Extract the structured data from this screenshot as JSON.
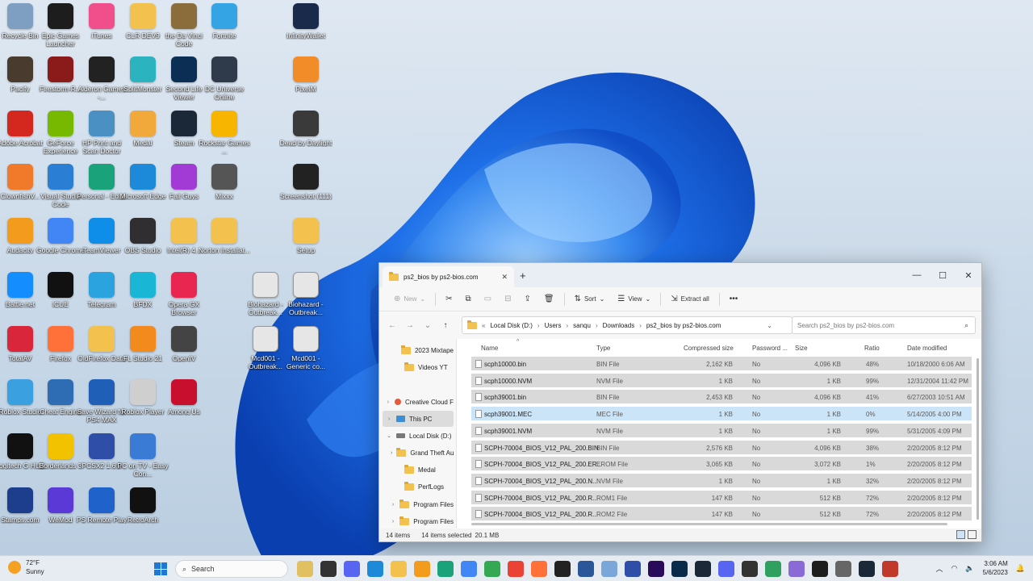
{
  "desktop": {
    "icons": [
      {
        "label": "Recycle Bin",
        "icon": "recycle-bin-icon",
        "color": "#7f9fc2"
      },
      {
        "label": "Epic Games Launcher",
        "icon": "epic-games-icon",
        "color": "#1d1d1d"
      },
      {
        "label": "iTunes",
        "icon": "itunes-icon",
        "color": "#f04f8c"
      },
      {
        "label": "CLR DEV9",
        "icon": "folder-icon",
        "color": "#f2c14e"
      },
      {
        "label": "the Da Vinci Code",
        "icon": "game-icon",
        "color": "#8a6d3b"
      },
      {
        "label": "Fortnite",
        "icon": "fortnite-icon",
        "color": "#35a4e5"
      },
      {
        "label": "InfinityWallet",
        "icon": "wallet-icon",
        "color": "#1a2a4a"
      },
      {
        "label": "Pacify",
        "icon": "game-icon",
        "color": "#4a3b2f"
      },
      {
        "label": "Firestorm-R...",
        "icon": "firestorm-icon",
        "color": "#8b1b1b"
      },
      {
        "label": "Alderon Games -...",
        "icon": "alderon-icon",
        "color": "#222222"
      },
      {
        "label": "SplitMonster",
        "icon": "app-icon",
        "color": "#2bb3c0"
      },
      {
        "label": "Second Life Viewer",
        "icon": "second-life-icon",
        "color": "#0b2e55"
      },
      {
        "label": "DC Universe Online",
        "icon": "game-icon",
        "color": "#2f3b4a"
      },
      {
        "label": "PixelM",
        "icon": "pixel-icon",
        "color": "#f28c28"
      },
      {
        "label": "Adobe Acrobat",
        "icon": "acrobat-icon",
        "color": "#d4271d"
      },
      {
        "label": "GeForce Experience",
        "icon": "nvidia-icon",
        "color": "#76b900"
      },
      {
        "label": "HP Print and Scan Doctor",
        "icon": "printer-icon",
        "color": "#4a90c2"
      },
      {
        "label": "Medal",
        "icon": "medal-icon",
        "color": "#f2a93b"
      },
      {
        "label": "Steam",
        "icon": "steam-icon",
        "color": "#1b2838"
      },
      {
        "label": "Rockstar Games ...",
        "icon": "rockstar-icon",
        "color": "#f7b500"
      },
      {
        "label": "Dead by Daylight",
        "icon": "dbd-icon",
        "color": "#3a3a3a"
      },
      {
        "label": "ClownfishV...",
        "icon": "clownfish-icon",
        "color": "#f07a2a"
      },
      {
        "label": "Visual Studio Code",
        "icon": "vscode-icon",
        "color": "#2a7fd4"
      },
      {
        "label": "Personal - Edge",
        "icon": "edge-icon",
        "color": "#1aa37a"
      },
      {
        "label": "Microsoft Edge",
        "icon": "edge-icon",
        "color": "#1c8ad8"
      },
      {
        "label": "Fall Guys",
        "icon": "fall-guys-icon",
        "color": "#a23bd6"
      },
      {
        "label": "Mixxx",
        "icon": "mixxx-icon",
        "color": "#555555"
      },
      {
        "label": "Screenshot (111)",
        "icon": "image-icon",
        "color": "#222222"
      },
      {
        "label": "Audacity",
        "icon": "audacity-icon",
        "color": "#f29b1d"
      },
      {
        "label": "Google Chrome",
        "icon": "chrome-icon",
        "color": "#4285f4"
      },
      {
        "label": "TeamViewer",
        "icon": "teamviewer-icon",
        "color": "#0e8ee9"
      },
      {
        "label": "OBS Studio",
        "icon": "obs-icon",
        "color": "#302e31"
      },
      {
        "label": "Intel(R) 4...",
        "icon": "folder-icon",
        "color": "#f2c14e"
      },
      {
        "label": "Norton Installat...",
        "icon": "folder-icon",
        "color": "#f2c14e"
      },
      {
        "label": "Setup",
        "icon": "folder-icon",
        "color": "#f2c14e"
      },
      {
        "label": "Battle.net",
        "icon": "battlenet-icon",
        "color": "#148eff"
      },
      {
        "label": "iCUE",
        "icon": "icue-icon",
        "color": "#111111"
      },
      {
        "label": "Telegram",
        "icon": "telegram-icon",
        "color": "#2aa3df"
      },
      {
        "label": "BFDX",
        "icon": "play-icon",
        "color": "#1ab6d6"
      },
      {
        "label": "Opera GX Browser",
        "icon": "opera-icon",
        "color": "#e8264f"
      },
      {
        "label": "Biohazard - Outbreak...",
        "icon": "file-icon",
        "color": "#e6e6e6"
      },
      {
        "label": "Biohazard - Outbreak...",
        "icon": "file-icon",
        "color": "#e6e6e6"
      },
      {
        "label": "TotalAV",
        "icon": "shield-icon",
        "color": "#d9263a"
      },
      {
        "label": "Firefox",
        "icon": "firefox-icon",
        "color": "#ff7139"
      },
      {
        "label": "OldFirefox Data",
        "icon": "folder-icon",
        "color": "#f2c14e"
      },
      {
        "label": "FL Studio 21",
        "icon": "fl-studio-icon",
        "color": "#f28a1e"
      },
      {
        "label": "OpenIV",
        "icon": "openiv-icon",
        "color": "#444444"
      },
      {
        "label": "Mcd001 - Outbreak...",
        "icon": "file-icon",
        "color": "#e6e6e6"
      },
      {
        "label": "Mcd001 - Generic co...",
        "icon": "file-icon",
        "color": "#e6e6e6"
      },
      {
        "label": "Roblox Studio",
        "icon": "roblox-studio-icon",
        "color": "#3aa0e0"
      },
      {
        "label": "Cheat Engine",
        "icon": "cheat-engine-icon",
        "color": "#2e6db4"
      },
      {
        "label": "Save Wizard for PS4 MAX",
        "icon": "save-wizard-icon",
        "color": "#1f5fb8"
      },
      {
        "label": "Roblox Player",
        "icon": "roblox-icon",
        "color": "#cfcfcf"
      },
      {
        "label": "Among Us",
        "icon": "among-us-icon",
        "color": "#c8102e"
      },
      {
        "label": "Logitech G HUB",
        "icon": "ghub-icon",
        "color": "#111111"
      },
      {
        "label": "Borderlands 3",
        "icon": "borderlands-icon",
        "color": "#f2c200"
      },
      {
        "label": "PCSX2 1.6.0",
        "icon": "pcsx2-icon",
        "color": "#2f4ea8"
      },
      {
        "label": "PC on TV - Easy Con...",
        "icon": "app-icon",
        "color": "#3a7bd5"
      },
      {
        "label": "Stamps.com",
        "icon": "stamps-icon",
        "color": "#1d3e8c"
      },
      {
        "label": "WeMod",
        "icon": "wemod-icon",
        "color": "#5a39d6"
      },
      {
        "label": "PS Remote Play",
        "icon": "ps-remote-icon",
        "color": "#1f62c9"
      },
      {
        "label": "RetroArch",
        "icon": "retroarch-icon",
        "color": "#111111"
      }
    ]
  },
  "explorer": {
    "tab_title": "ps2_bios by ps2-bios.com",
    "toolbar": {
      "new_label": "New",
      "sort_label": "Sort",
      "view_label": "View",
      "extract_label": "Extract all"
    },
    "breadcrumb": [
      "Local Disk (D:)",
      "Users",
      "sanqu",
      "Downloads",
      "ps2_bios by ps2-bios.com"
    ],
    "search_placeholder": "Search ps2_bios by ps2-bios.com",
    "nav": [
      {
        "label": "2023 Mixtape",
        "icon": "folder-icon"
      },
      {
        "label": "Videos YT",
        "icon": "folder-icon"
      },
      {
        "label": "Creative Cloud F",
        "icon": "cloud-icon"
      },
      {
        "label": "This PC",
        "icon": "pc-icon"
      },
      {
        "label": "Local Disk (D:)",
        "icon": "drive-icon"
      },
      {
        "label": "Grand Theft Au",
        "icon": "folder-icon"
      },
      {
        "label": "Medal",
        "icon": "folder-icon"
      },
      {
        "label": "PerfLogs",
        "icon": "folder-icon"
      },
      {
        "label": "Program Files",
        "icon": "folder-icon"
      },
      {
        "label": "Program Files",
        "icon": "folder-icon"
      }
    ],
    "columns": [
      "Name",
      "Type",
      "Compressed size",
      "Password ...",
      "Size",
      "Ratio",
      "Date modified"
    ],
    "files": [
      {
        "name": "scph10000.bin",
        "type": "BIN File",
        "compressed": "2,162 KB",
        "password": "No",
        "size": "4,096 KB",
        "ratio": "48%",
        "date": "10/18/2000 6:06 AM"
      },
      {
        "name": "scph10000.NVM",
        "type": "NVM File",
        "compressed": "1 KB",
        "password": "No",
        "size": "1 KB",
        "ratio": "99%",
        "date": "12/31/2004 11:42 PM"
      },
      {
        "name": "scph39001.bin",
        "type": "BIN File",
        "compressed": "2,453 KB",
        "password": "No",
        "size": "4,096 KB",
        "ratio": "41%",
        "date": "6/27/2003 10:51 AM"
      },
      {
        "name": "scph39001.MEC",
        "type": "MEC File",
        "compressed": "1 KB",
        "password": "No",
        "size": "1 KB",
        "ratio": "0%",
        "date": "5/14/2005 4:00 PM"
      },
      {
        "name": "scph39001.NVM",
        "type": "NVM File",
        "compressed": "1 KB",
        "password": "No",
        "size": "1 KB",
        "ratio": "99%",
        "date": "5/31/2005 4:09 PM"
      },
      {
        "name": "SCPH-70004_BIOS_V12_PAL_200.BIN",
        "type": "BIN File",
        "compressed": "2,576 KB",
        "password": "No",
        "size": "4,096 KB",
        "ratio": "38%",
        "date": "2/20/2005 8:12 PM"
      },
      {
        "name": "SCPH-70004_BIOS_V12_PAL_200.ER...",
        "type": "EROM File",
        "compressed": "3,065 KB",
        "password": "No",
        "size": "3,072 KB",
        "ratio": "1%",
        "date": "2/20/2005 8:12 PM"
      },
      {
        "name": "SCPH-70004_BIOS_V12_PAL_200.N...",
        "type": "NVM File",
        "compressed": "1 KB",
        "password": "No",
        "size": "1 KB",
        "ratio": "32%",
        "date": "2/20/2005 8:12 PM"
      },
      {
        "name": "SCPH-70004_BIOS_V12_PAL_200.R...",
        "type": "ROM1 File",
        "compressed": "147 KB",
        "password": "No",
        "size": "512 KB",
        "ratio": "72%",
        "date": "2/20/2005 8:12 PM"
      },
      {
        "name": "SCPH-70004_BIOS_V12_PAL_200.R...",
        "type": "ROM2 File",
        "compressed": "147 KB",
        "password": "No",
        "size": "512 KB",
        "ratio": "72%",
        "date": "2/20/2005 8:12 PM"
      }
    ],
    "status": {
      "count": "14 items",
      "selected": "14 items selected",
      "size": "20.1 MB"
    }
  },
  "taskbar": {
    "weather_temp": "72°F",
    "weather_desc": "Sunny",
    "search_label": "Search",
    "time": "3:06 AM",
    "date": "5/6/2023",
    "apps": [
      {
        "name": "shrine-app-icon",
        "color": "#e0c060"
      },
      {
        "name": "terminal-icon",
        "color": "#333333"
      },
      {
        "name": "discord-icon",
        "color": "#5865f2"
      },
      {
        "name": "edge-icon",
        "color": "#1c8ad8"
      },
      {
        "name": "file-explorer-icon",
        "color": "#f2c14e"
      },
      {
        "name": "audacity-icon",
        "color": "#f29b1d"
      },
      {
        "name": "edge-icon",
        "color": "#1aa37a"
      },
      {
        "name": "chrome-icon",
        "color": "#4285f4"
      },
      {
        "name": "chrome-icon",
        "color": "#34a853"
      },
      {
        "name": "chrome-icon",
        "color": "#ea4335"
      },
      {
        "name": "firefox-icon",
        "color": "#ff7139"
      },
      {
        "name": "alderon-icon",
        "color": "#222222"
      },
      {
        "name": "word-icon",
        "color": "#2b579a"
      },
      {
        "name": "image-icon",
        "color": "#7aa6d9"
      },
      {
        "name": "pcsx2-icon",
        "color": "#2f4ea8"
      },
      {
        "name": "premiere-icon",
        "color": "#2a0a5a"
      },
      {
        "name": "photoshop-icon",
        "color": "#0b2b4a"
      },
      {
        "name": "steam-icon",
        "color": "#1b2838"
      },
      {
        "name": "discord-icon",
        "color": "#5865f2"
      },
      {
        "name": "7zip-icon",
        "color": "#333333"
      },
      {
        "name": "notepad-icon",
        "color": "#2fa060"
      },
      {
        "name": "controller-icon",
        "color": "#8a6ad6"
      },
      {
        "name": "epic-games-icon",
        "color": "#1d1d1d"
      },
      {
        "name": "settings-icon",
        "color": "#666666"
      },
      {
        "name": "steam-icon",
        "color": "#1b2838"
      },
      {
        "name": "game-icon",
        "color": "#c0392b"
      }
    ]
  }
}
